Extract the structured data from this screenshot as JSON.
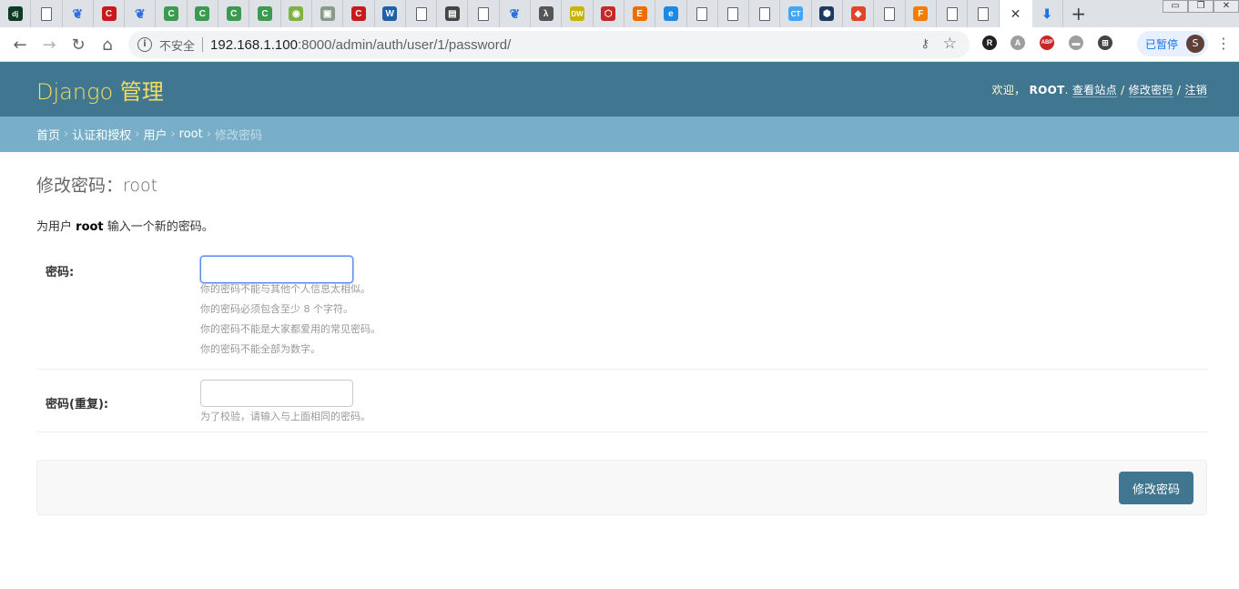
{
  "browser": {
    "tabs": [
      {
        "icon": "django-icon",
        "glyph": "dj",
        "color": "#0c3c26"
      },
      {
        "icon": "document-icon",
        "glyph": "",
        "color": ""
      },
      {
        "icon": "baidu-paw-icon",
        "glyph": "🐾",
        "color": "#2e6fe0"
      },
      {
        "icon": "csdn-icon",
        "glyph": "C",
        "color": "#c71a1a"
      },
      {
        "icon": "baidu-paw-icon",
        "glyph": "🐾",
        "color": "#2e6fe0"
      },
      {
        "icon": "green-c-icon",
        "glyph": "C",
        "color": "#3a9a4f"
      },
      {
        "icon": "green-c-icon",
        "glyph": "C",
        "color": "#3a9a4f"
      },
      {
        "icon": "green-c-icon",
        "glyph": "C",
        "color": "#3a9a4f"
      },
      {
        "icon": "green-c-icon",
        "glyph": "C",
        "color": "#3a9a4f"
      },
      {
        "icon": "android-icon",
        "glyph": "◉",
        "color": "#7cb342"
      },
      {
        "icon": "image-icon",
        "glyph": "▣",
        "color": "#8a9a8a"
      },
      {
        "icon": "csdn-icon",
        "glyph": "C",
        "color": "#c71a1a"
      },
      {
        "icon": "w-icon",
        "glyph": "W",
        "color": "#1e5fa8"
      },
      {
        "icon": "document-icon",
        "glyph": "",
        "color": ""
      },
      {
        "icon": "book-icon",
        "glyph": "▤",
        "color": "#444444"
      },
      {
        "icon": "document-icon",
        "glyph": "",
        "color": ""
      },
      {
        "icon": "baidu-paw-icon",
        "glyph": "🐾",
        "color": "#2e6fe0"
      },
      {
        "icon": "lambda-icon",
        "glyph": "λ",
        "color": "#555555"
      },
      {
        "icon": "dw-icon",
        "glyph": "DW",
        "color": "#c8b400"
      },
      {
        "icon": "hexagon-red-icon",
        "glyph": "⬡",
        "color": "#c62828"
      },
      {
        "icon": "e-icon",
        "glyph": "E",
        "color": "#ef6c00"
      },
      {
        "icon": "swirl-icon",
        "glyph": "e",
        "color": "#1e88e5"
      },
      {
        "icon": "document-icon",
        "glyph": "",
        "color": ""
      },
      {
        "icon": "document-icon",
        "glyph": "",
        "color": ""
      },
      {
        "icon": "document-icon",
        "glyph": "",
        "color": ""
      },
      {
        "icon": "ct-icon",
        "glyph": "CT",
        "color": "#42a5f5"
      },
      {
        "icon": "hexagon-blue-icon",
        "glyph": "⬢",
        "color": "#1e3a5f"
      },
      {
        "icon": "gitlab-icon",
        "glyph": "◆",
        "color": "#e24329"
      },
      {
        "icon": "document-icon",
        "glyph": "",
        "color": ""
      },
      {
        "icon": "f-icon",
        "glyph": "F",
        "color": "#f57c00"
      },
      {
        "icon": "document-icon",
        "glyph": "",
        "color": ""
      },
      {
        "icon": "document-icon",
        "glyph": "",
        "color": ""
      }
    ],
    "active_tab_close": "✕",
    "download_tab_glyph": "⬇",
    "new_tab": "+",
    "win_controls": [
      "▭",
      "❐",
      "✕"
    ],
    "omnibox": {
      "insecure": "不安全",
      "host": "192.168.1.100",
      "path": ":8000/admin/auth/user/1/password/"
    },
    "paused_label": "已暂停",
    "avatar_letter": "S",
    "extensions": [
      {
        "name": "r-extension-icon",
        "glyph": "R",
        "color": "#222222"
      },
      {
        "name": "pdf-extension-icon",
        "glyph": "A",
        "color": "#9e9e9e"
      },
      {
        "name": "adblock-extension-icon",
        "glyph": "ABP",
        "color": "#c62828"
      },
      {
        "name": "screen-extension-icon",
        "glyph": "▬",
        "color": "#9e9e9e"
      },
      {
        "name": "crop-extension-icon",
        "glyph": "⊞",
        "color": "#444444"
      }
    ]
  },
  "admin": {
    "branding": "Django 管理",
    "user_tools": {
      "welcome": "欢迎，",
      "username": "ROOT",
      "view_site": "查看站点",
      "change_password": "修改密码",
      "logout": "注销"
    },
    "breadcrumbs": [
      "首页",
      "认证和授权",
      "用户",
      "root"
    ],
    "breadcrumb_current": "修改密码",
    "page_title": "修改密码：root",
    "intro_prefix": "为用户",
    "intro_user": "root",
    "intro_suffix": "输入一个新的密码。",
    "fields": {
      "password1_label": "密码:",
      "password1_value": "",
      "password1_help": [
        "你的密码不能与其他个人信息太相似。",
        "你的密码必须包含至少 8 个字符。",
        "你的密码不能是大家都爱用的常见密码。",
        "你的密码不能全部为数字。"
      ],
      "password2_label": "密码(重复):",
      "password2_value": "",
      "password2_help": "为了校验，请输入与上面相同的密码。"
    },
    "submit_label": "修改密码"
  }
}
